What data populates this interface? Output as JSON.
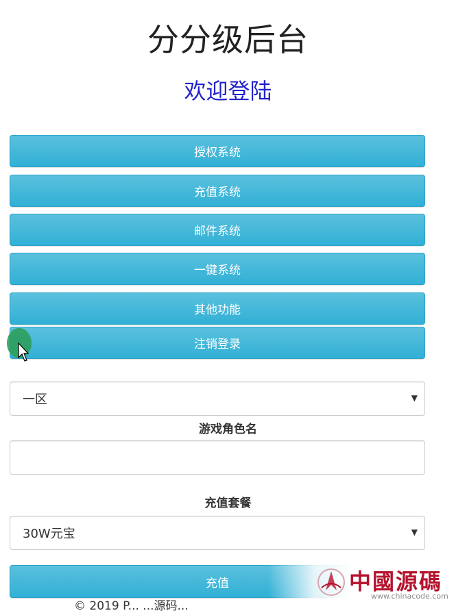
{
  "header": {
    "title": "分分级后台",
    "subtitle": "欢迎登陆"
  },
  "nav": {
    "items": [
      {
        "label": "授权系统"
      },
      {
        "label": "充值系统"
      },
      {
        "label": "邮件系统"
      },
      {
        "label": "一键系统"
      },
      {
        "label": "其他功能"
      },
      {
        "label": "注销登录"
      }
    ]
  },
  "form": {
    "server_select": {
      "value": "一区"
    },
    "role_label": "游戏角色名",
    "role_input": {
      "value": "",
      "placeholder": ""
    },
    "package_label": "充值套餐",
    "package_select": {
      "value": "30W元宝"
    },
    "submit_label": "充值"
  },
  "footer": {
    "text": "© 2019 P...  ...源码..."
  },
  "watermark": {
    "brand": "中國源碼",
    "url": "www.chinacode.com"
  },
  "colors": {
    "button": "#5bc0de",
    "subtitle": "#2222cc"
  }
}
